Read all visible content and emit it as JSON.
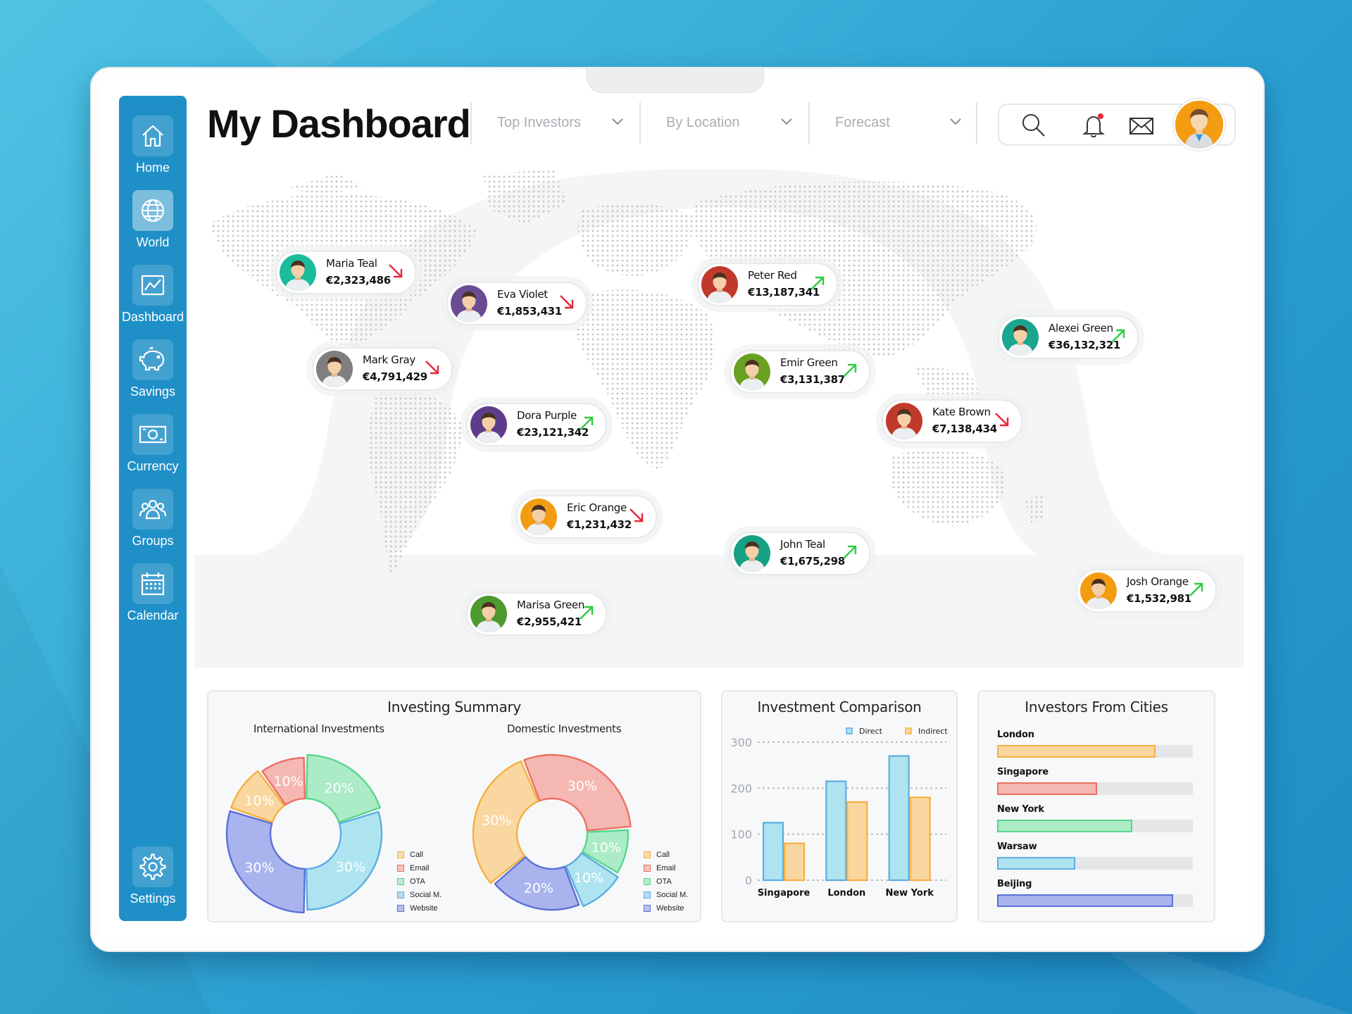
{
  "header": {
    "title": "My Dashboard"
  },
  "filters": [
    {
      "label": "Top Investors"
    },
    {
      "label": "By Location"
    },
    {
      "label": "Forecast"
    }
  ],
  "topbar": {
    "has_notification": true
  },
  "sidebar": {
    "items": [
      {
        "label": "Home",
        "icon": "home-icon",
        "active": false
      },
      {
        "label": "World",
        "icon": "globe-icon",
        "active": true
      },
      {
        "label": "Dashboard",
        "icon": "chart-line-icon",
        "active": false
      },
      {
        "label": "Savings",
        "icon": "piggy-bank-icon",
        "active": false
      },
      {
        "label": "Currency",
        "icon": "banknote-icon",
        "active": false
      },
      {
        "label": "Groups",
        "icon": "users-icon",
        "active": false
      },
      {
        "label": "Calendar",
        "icon": "calendar-icon",
        "active": false
      }
    ],
    "settings": {
      "label": "Settings",
      "icon": "gear-icon"
    }
  },
  "investors": [
    {
      "name": "Maria Teal",
      "amount": "€2,323,486",
      "trend": "down",
      "avatar_color": "#1abc9c"
    },
    {
      "name": "Eva Violet",
      "amount": "€1,853,431",
      "trend": "down",
      "avatar_color": "#6a4c93"
    },
    {
      "name": "Mark Gray",
      "amount": "€4,791,429",
      "trend": "down",
      "avatar_color": "#7f7f7f"
    },
    {
      "name": "Dora Purple",
      "amount": "€23,121,342",
      "trend": "up",
      "avatar_color": "#5e3c8c"
    },
    {
      "name": "Eric Orange",
      "amount": "€1,231,432",
      "trend": "down",
      "avatar_color": "#f39c12"
    },
    {
      "name": "Marisa Green",
      "amount": "€2,955,421",
      "trend": "up",
      "avatar_color": "#4e9a2f"
    },
    {
      "name": "Peter Red",
      "amount": "€13,187,341",
      "trend": "up",
      "avatar_color": "#c0392b"
    },
    {
      "name": "Emir Green",
      "amount": "€3,131,387",
      "trend": "up",
      "avatar_color": "#6aa121"
    },
    {
      "name": "John Teal",
      "amount": "€1,675,298",
      "trend": "up",
      "avatar_color": "#16a085"
    },
    {
      "name": "Alexei Green",
      "amount": "€36,132,321",
      "trend": "up",
      "avatar_color": "#1aa58f"
    },
    {
      "name": "Kate Brown",
      "amount": "€7,138,434",
      "trend": "down",
      "avatar_color": "#c0392b"
    },
    {
      "name": "Josh Orange",
      "amount": "€1,532,981",
      "trend": "up",
      "avatar_color": "#f39c12"
    }
  ],
  "colors": {
    "up": "#2ecc40",
    "down": "#e8263a",
    "sidebar": "#1f8fc7"
  },
  "chart_data": [
    {
      "type": "pie",
      "panel_title": "Investing Summary",
      "title": "International Investments",
      "slices": [
        {
          "label": "Call",
          "value": 10
        },
        {
          "label": "Email",
          "value": 10
        },
        {
          "label": "OTA",
          "value": 20
        },
        {
          "label": "Social M.",
          "value": 30
        },
        {
          "label": "Website",
          "value": 30
        }
      ],
      "slice_labels": [
        "10%",
        "10%",
        "20%",
        "30%",
        "30%"
      ]
    },
    {
      "type": "pie",
      "title": "Domestic Investments",
      "slices": [
        {
          "label": "Email",
          "value": 30
        },
        {
          "label": "OTA",
          "value": 10
        },
        {
          "label": "Social M.",
          "value": 10
        },
        {
          "label": "Website",
          "value": 20
        },
        {
          "label": "Call",
          "value": 30
        }
      ],
      "slice_labels": [
        "30%",
        "10%",
        "10%",
        "20%",
        "30%"
      ]
    },
    {
      "type": "bar",
      "title": "Investment Comparison",
      "categories": [
        "Singapore",
        "London",
        "New York"
      ],
      "series": [
        {
          "name": "Direct",
          "values": [
            125,
            215,
            270
          ]
        },
        {
          "name": "Indirect",
          "values": [
            80,
            170,
            180
          ]
        }
      ],
      "ylim": [
        0,
        300
      ],
      "yticks": [
        "300",
        "200",
        "100",
        "0"
      ]
    },
    {
      "type": "bar",
      "orientation": "horizontal",
      "title": "Investors From Cities",
      "categories": [
        "London",
        "Singapore",
        "New York",
        "Warsaw",
        "Beijing"
      ],
      "values": [
        0.81,
        0.51,
        0.69,
        0.4,
        0.9
      ]
    }
  ],
  "legend": {
    "labels": [
      "Call",
      "Email",
      "OTA",
      "Social M.",
      "Website"
    ],
    "colors": [
      "#f5b041",
      "#ec7063",
      "#58d68d",
      "#5dade2",
      "#5b6fd6"
    ]
  },
  "palette": {
    "call": "#fad7a0",
    "email": "#f5b7b1",
    "ota": "#abebc6",
    "social": "#aee4ef",
    "website": "#a9b4ee",
    "call_stroke": "#f5b041",
    "email_stroke": "#ec7063",
    "ota_stroke": "#58d68d",
    "social_stroke": "#5dade2",
    "website_stroke": "#5b6fd6"
  }
}
